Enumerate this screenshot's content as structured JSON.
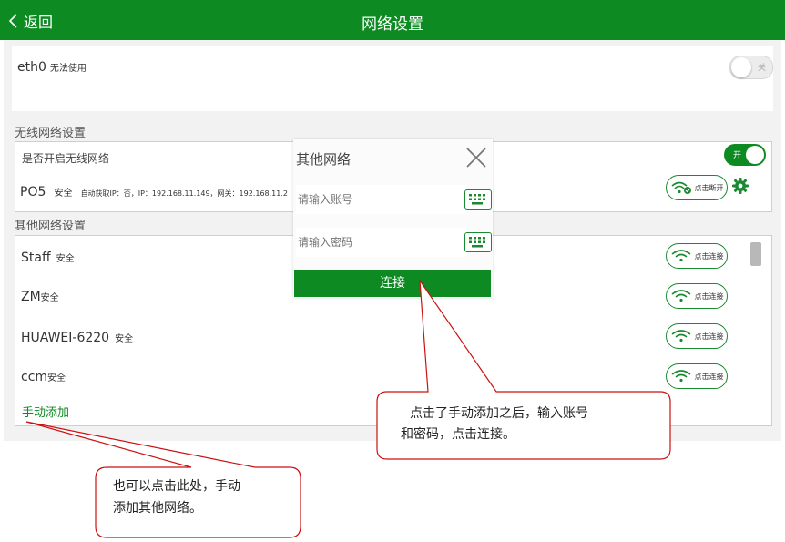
{
  "header": {
    "back_label": "返回",
    "title": "网络设置"
  },
  "eth": {
    "name": "eth0",
    "status": "无法使用",
    "toggle_label": "关"
  },
  "wireless": {
    "section_title": "无线网络设置",
    "enable_label": "是否开启无线网络",
    "toggle_label": "开",
    "connected": {
      "name": "PO5",
      "security": "安全",
      "details": "自动获取IP：否，IP：192.168.11.149，网关：192.168.11.2",
      "button_label": "点击断开"
    }
  },
  "other": {
    "section_title": "其他网络设置",
    "networks": [
      {
        "name": "Staff",
        "security": "安全",
        "button_label": "点击连接"
      },
      {
        "name": "ZM",
        "security": "安全",
        "button_label": "点击连接"
      },
      {
        "name": "HUAWEI-6220",
        "security": "安全",
        "button_label": "点击连接"
      },
      {
        "name": "ccm",
        "security": "安全",
        "button_label": "点击连接"
      }
    ],
    "manual_add_label": "手动添加"
  },
  "dialog": {
    "title": "其他网络",
    "account_placeholder": "请输入账号",
    "password_placeholder": "请输入密码",
    "connect_label": "连接"
  },
  "callouts": {
    "dialog_note_line1": "点击了手动添加之后，输入账号",
    "dialog_note_line2": "和密码，点击连接。",
    "manual_note_line1": "也可以点击此处，手动",
    "manual_note_line2": "添加其他网络。"
  },
  "colors": {
    "accent": "#0e8a22",
    "callout_stroke": "#cc1111"
  }
}
